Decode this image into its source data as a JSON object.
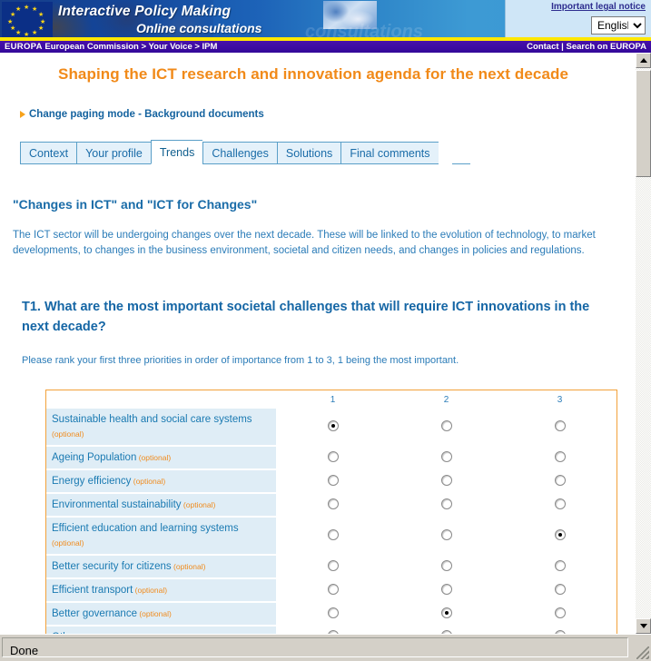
{
  "banner": {
    "title": "Interactive Policy Making",
    "subtitle": "Online consultations",
    "watermark": "consultations",
    "legal_notice": "Important legal notice",
    "language": "English",
    "language_options": [
      "English"
    ]
  },
  "breadcrumb": {
    "europa": "EUROPA",
    "path": "European Commission > Your Voice > IPM",
    "contact": "Contact",
    "separator": "|",
    "search": "Search on EUROPA"
  },
  "page": {
    "title": "Shaping the ICT research and innovation agenda for the next decade",
    "paging_link": "Change paging mode - Background documents"
  },
  "tabs": [
    {
      "label": "Context",
      "active": false
    },
    {
      "label": "Your profile",
      "active": false
    },
    {
      "label": "Trends",
      "active": true
    },
    {
      "label": "Challenges",
      "active": false
    },
    {
      "label": "Solutions",
      "active": false
    },
    {
      "label": "Final comments",
      "active": false
    }
  ],
  "section": {
    "heading": "\"Changes in ICT\" and \"ICT for Changes\"",
    "body": "The ICT sector will be undergoing changes over the next decade. These will be linked to the evolution of technology, to market developments, to changes in the business environment, societal and citizen needs, and changes in policies and regulations."
  },
  "question": {
    "text": "T1. What are the most important societal challenges that will require ICT innovations in the next decade?",
    "help": "Please rank your first three priorities in order of importance from 1 to 3, 1 being the most important.",
    "optional_tag": "(optional)",
    "columns": [
      "1",
      "2",
      "3"
    ],
    "rows": [
      {
        "label": "Sustainable health and social care systems",
        "optional": true,
        "selected": 1
      },
      {
        "label": "Ageing Population",
        "optional": true,
        "selected": 0
      },
      {
        "label": "Energy efficiency",
        "optional": true,
        "selected": 0
      },
      {
        "label": "Environmental sustainability",
        "optional": true,
        "selected": 0
      },
      {
        "label": "Efficient education and learning systems",
        "optional": true,
        "selected": 3
      },
      {
        "label": "Better security for citizens",
        "optional": true,
        "selected": 0
      },
      {
        "label": "Efficient transport",
        "optional": true,
        "selected": 0
      },
      {
        "label": "Better governance",
        "optional": true,
        "selected": 2
      },
      {
        "label": "Other",
        "optional": true,
        "selected": 0
      }
    ]
  },
  "status": {
    "text": "Done"
  },
  "colors": {
    "accent_orange": "#f18a19",
    "link_blue": "#15639f",
    "text_blue": "#2b7cb8",
    "banner_blue": "#14479c",
    "crumb_purple": "#3d0f9e",
    "table_border": "#f2a13a",
    "row_bg": "#dfedf6"
  }
}
